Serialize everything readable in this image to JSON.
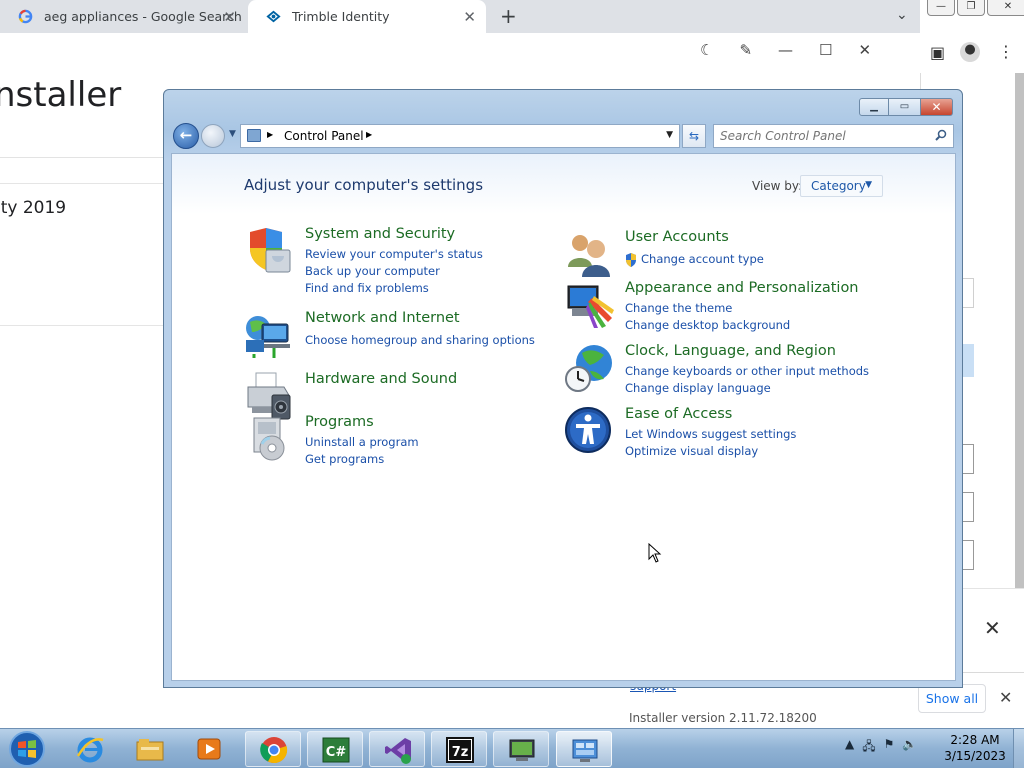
{
  "browser": {
    "tabs": [
      {
        "label": "aeg appliances - Google Search",
        "active": false
      },
      {
        "label": "Trimble Identity",
        "active": true
      }
    ],
    "page_heading": "nstaller",
    "card_text": "ity 2019",
    "notice_link": "support",
    "installer_version": "Installer version 2.11.72.18200",
    "show_all": "Show all"
  },
  "control_panel": {
    "address": "Control Panel",
    "search_placeholder": "Search Control Panel",
    "heading": "Adjust your computer's settings",
    "view_by_label": "View by:",
    "view_by_value": "Category",
    "categories_left": [
      {
        "title": "System and Security",
        "icon": "shield-icon",
        "links": [
          "Review your computer's status",
          "Back up your computer",
          "Find and fix problems"
        ]
      },
      {
        "title": "Network and Internet",
        "icon": "network-icon",
        "links": [
          "Choose homegroup and sharing options"
        ]
      },
      {
        "title": "Hardware and Sound",
        "icon": "printer-icon",
        "links": []
      },
      {
        "title": "Programs",
        "icon": "programs-icon",
        "links": [
          "Uninstall a program",
          "Get programs"
        ]
      }
    ],
    "categories_right": [
      {
        "title": "User Accounts",
        "icon": "users-icon",
        "links": [
          "Change account type"
        ]
      },
      {
        "title": "Appearance and Personalization",
        "icon": "appearance-icon",
        "links": [
          "Change the theme",
          "Change desktop background"
        ]
      },
      {
        "title": "Clock, Language, and Region",
        "icon": "globe-clock-icon",
        "links": [
          "Change keyboards or other input methods",
          "Change display language"
        ]
      },
      {
        "title": "Ease of Access",
        "icon": "ease-of-access-icon",
        "links": [
          "Let Windows suggest settings",
          "Optimize visual display"
        ]
      }
    ]
  },
  "taskbar": {
    "time": "2:28 AM",
    "date": "3/15/2023",
    "items": [
      "start-orb",
      "internet-explorer",
      "file-explorer",
      "media-player",
      "chrome",
      "csharp",
      "visual-studio",
      "7zip",
      "display-tool",
      "control-panel"
    ]
  },
  "colors": {
    "category_title": "#1c6b24",
    "link": "#1a4fa8",
    "heading": "#1e3a6e"
  }
}
